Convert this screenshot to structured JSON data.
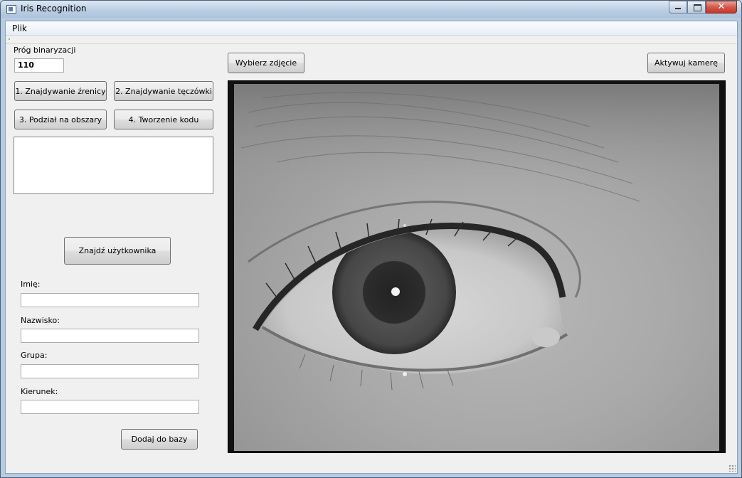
{
  "window": {
    "title": "Iris Recognition",
    "icon": "app-window-icon",
    "controls": {
      "minimize": "minimize-icon",
      "maximize": "maximize-icon",
      "close": "close-icon"
    }
  },
  "menu": {
    "items": [
      "Plik"
    ]
  },
  "left_panel": {
    "threshold_label": "Próg binaryzacji",
    "threshold_value": "110",
    "step_buttons": [
      "1. Znajdywanie źrenicy",
      "2. Znajdywanie tęczówki",
      "3. Podział na obszary",
      "4. Tworzenie kodu"
    ],
    "output_text": "",
    "find_user_button": "Znajdź użytkownika",
    "fields": {
      "first_name": {
        "label": "Imię:",
        "value": ""
      },
      "last_name": {
        "label": "Nazwisko:",
        "value": ""
      },
      "group": {
        "label": "Grupa:",
        "value": ""
      },
      "major": {
        "label": "Kierunek:",
        "value": ""
      }
    },
    "add_button": "Dodaj do bazy"
  },
  "right_panel": {
    "select_photo_button": "Wybierz zdjęcie",
    "activate_camera_button": "Aktywuj kamerę",
    "image": "grayscale-eye-photo"
  }
}
